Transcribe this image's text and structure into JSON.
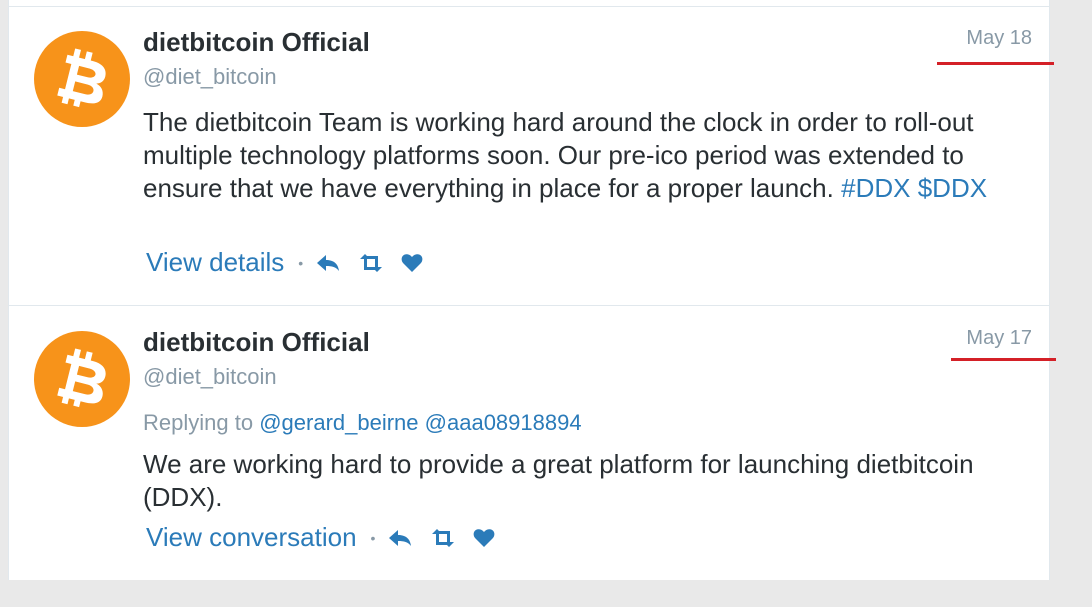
{
  "colors": {
    "link": "#2b7bb9",
    "accent_line": "#d42027",
    "avatar_bg": "#f7931a"
  },
  "tweets": [
    {
      "author": "dietbitcoin Official",
      "handle": "@diet_bitcoin",
      "date": "May 18",
      "text_plain": "The dietbitcoin Team is working hard around the clock in order to roll-out multiple technology platforms soon. Our pre-ico period was extended to ensure that we have everything in place for a proper launch.",
      "hashtag": "#DDX",
      "cashtag": "$DDX",
      "action_link": "View details",
      "icons": [
        "reply-icon",
        "retweet-icon",
        "like-icon"
      ]
    },
    {
      "author": "dietbitcoin Official",
      "handle": "@diet_bitcoin",
      "date": "May 17",
      "replying_label": "Replying to",
      "mentions": [
        "@gerard_beirne",
        "@aaa08918894"
      ],
      "text": "We are working hard to provide a great platform for launching dietbitcoin (DDX).",
      "action_link": "View conversation",
      "icons": [
        "reply-icon",
        "retweet-icon",
        "like-icon"
      ]
    }
  ]
}
